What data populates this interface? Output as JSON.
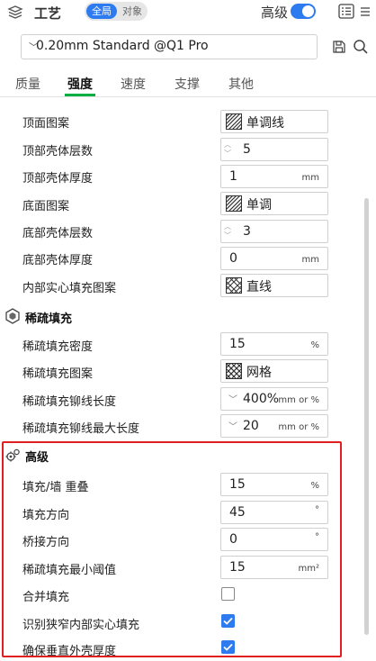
{
  "header": {
    "title": "工艺",
    "scope_global": "全局",
    "scope_object": "对象",
    "advanced_label": "高级",
    "advanced_enabled": true
  },
  "preset": {
    "name": "0.20mm Standard @Q1 Pro"
  },
  "tabs": [
    {
      "label": "质量"
    },
    {
      "label": "强度",
      "active": true
    },
    {
      "label": "速度"
    },
    {
      "label": "支撑"
    },
    {
      "label": "其他"
    }
  ],
  "strength": {
    "top_pattern": {
      "label": "顶面图案",
      "value": "单调线"
    },
    "top_shell_layers": {
      "label": "顶部壳体层数",
      "value": "5"
    },
    "top_shell_thickness": {
      "label": "顶部壳体厚度",
      "value": "1",
      "unit": "mm"
    },
    "bottom_pattern": {
      "label": "底面图案",
      "value": "单调"
    },
    "bottom_shell_layers": {
      "label": "底部壳体层数",
      "value": "3"
    },
    "bottom_shell_thickness": {
      "label": "底部壳体厚度",
      "value": "0",
      "unit": "mm"
    },
    "internal_solid_pattern": {
      "label": "内部实心填充图案",
      "value": "直线"
    }
  },
  "sparse_infill": {
    "title": "稀疏填充",
    "density": {
      "label": "稀疏填充密度",
      "value": "15",
      "unit": "%"
    },
    "pattern": {
      "label": "稀疏填充图案",
      "value": "网格"
    },
    "anchor_length": {
      "label": "稀疏填充铆线长度",
      "value": "400%",
      "unit": "mm or %"
    },
    "anchor_max": {
      "label": "稀疏填充铆线最大长度",
      "value": "20",
      "unit": "mm or %"
    }
  },
  "advanced": {
    "title": "高级",
    "infill_wall_overlap": {
      "label": "填充/墙 重叠",
      "value": "15",
      "unit": "%"
    },
    "infill_direction": {
      "label": "填充方向",
      "value": "45",
      "unit": "°"
    },
    "bridge_direction": {
      "label": "桥接方向",
      "value": "0",
      "unit": "°"
    },
    "min_sparse_threshold": {
      "label": "稀疏填充最小阈值",
      "value": "15",
      "unit": "mm²"
    },
    "merge_infill": {
      "label": "合并填充",
      "checked": false
    },
    "detect_narrow_solid": {
      "label": "识别狭窄内部实心填充",
      "checked": true
    },
    "ensure_vertical_shell": {
      "label": "确保垂直外壳厚度",
      "checked": true
    }
  },
  "colors": {
    "accent": "#2e7bf0",
    "tab_underline": "#00ae42",
    "highlight": "#e02020"
  }
}
